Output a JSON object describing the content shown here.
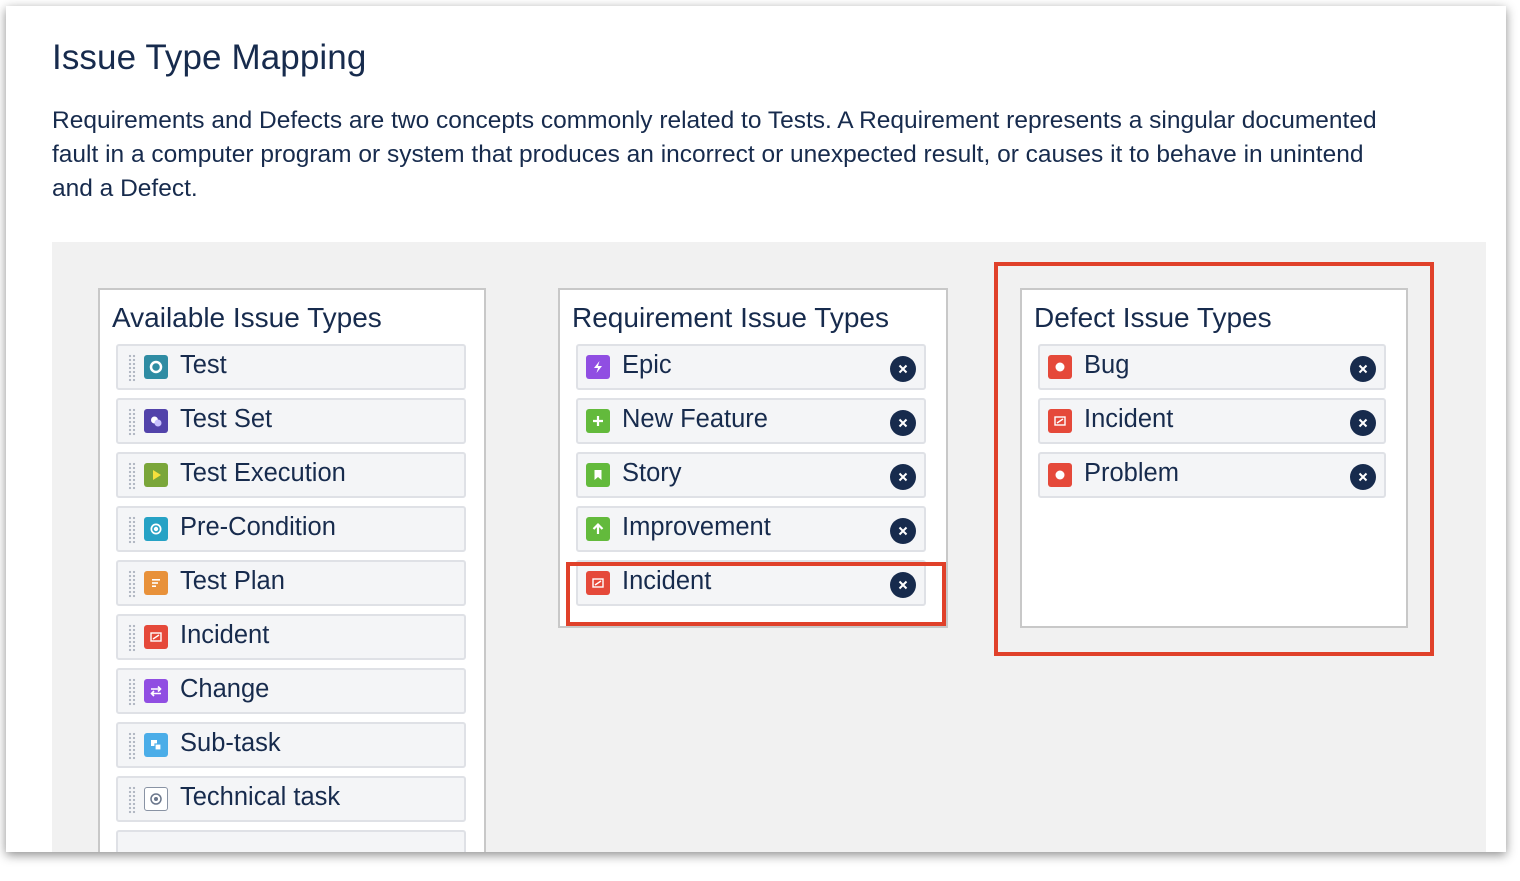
{
  "page": {
    "title": "Issue Type Mapping",
    "description_lines": [
      "Requirements and Defects are two concepts commonly related to Tests. A Requirement represents a singular documented",
      "fault in a computer program or system that produces an incorrect or unexpected result, or causes it to behave in unintend",
      "and a Defect."
    ]
  },
  "panels": {
    "available": {
      "title": "Available Issue Types",
      "items": [
        {
          "label": "Test",
          "icon": "test-icon",
          "color": "#2f8ca3"
        },
        {
          "label": "Test Set",
          "icon": "test-set-icon",
          "color": "#5243aa"
        },
        {
          "label": "Test Execution",
          "icon": "test-execution-icon",
          "color": "#7aa63a"
        },
        {
          "label": "Pre-Condition",
          "icon": "pre-condition-icon",
          "color": "#26a2c5"
        },
        {
          "label": "Test Plan",
          "icon": "test-plan-icon",
          "color": "#e8913a"
        },
        {
          "label": "Incident",
          "icon": "incident-icon",
          "color": "#e5493a"
        },
        {
          "label": "Change",
          "icon": "change-icon",
          "color": "#904ee2"
        },
        {
          "label": "Sub-task",
          "icon": "sub-task-icon",
          "color": "#4bade8"
        },
        {
          "label": "Technical task",
          "icon": "technical-task-icon",
          "color": "#8993a4"
        }
      ]
    },
    "requirement": {
      "title": "Requirement Issue Types",
      "items": [
        {
          "label": "Epic",
          "icon": "epic-icon",
          "color": "#904ee2"
        },
        {
          "label": "New Feature",
          "icon": "new-feature-icon",
          "color": "#63ba3c"
        },
        {
          "label": "Story",
          "icon": "story-icon",
          "color": "#63ba3c"
        },
        {
          "label": "Improvement",
          "icon": "improvement-icon",
          "color": "#63ba3c"
        },
        {
          "label": "Incident",
          "icon": "incident-icon",
          "color": "#e5493a"
        }
      ]
    },
    "defect": {
      "title": "Defect Issue Types",
      "items": [
        {
          "label": "Bug",
          "icon": "bug-icon",
          "color": "#e5493a"
        },
        {
          "label": "Incident",
          "icon": "incident-icon",
          "color": "#e5493a"
        },
        {
          "label": "Problem",
          "icon": "problem-icon",
          "color": "#e5493a"
        }
      ]
    }
  },
  "colors": {
    "highlight": "#e0412a",
    "remove_button": "#172b4d"
  }
}
